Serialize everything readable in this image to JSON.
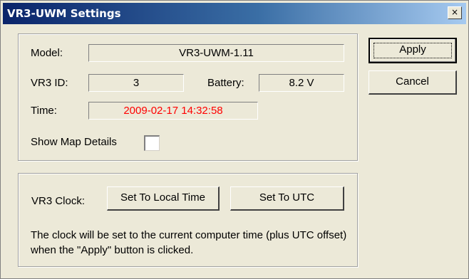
{
  "window": {
    "title": "VR3-UWM Settings",
    "close_glyph": "×"
  },
  "device": {
    "model_label": "Model:",
    "model_value": "VR3-UWM-1.11",
    "id_label": "VR3 ID:",
    "id_value": "3",
    "battery_label": "Battery:",
    "battery_value": "8.2 V",
    "time_label": "Time:",
    "time_value": "2009-02-17  14:32:58",
    "time_color": "#ff0000",
    "map_details_label": "Show Map Details",
    "map_details_checked": false
  },
  "clock": {
    "label": "VR3 Clock:",
    "local_button": "Set To Local Time",
    "utc_button": "Set To UTC",
    "note": "The clock will be set to the current computer time (plus UTC offset) when the \"Apply\" button is clicked."
  },
  "actions": {
    "apply": "Apply",
    "cancel": "Cancel"
  },
  "icons": {
    "close": "close-icon",
    "checkbox": "checkbox-unchecked"
  }
}
